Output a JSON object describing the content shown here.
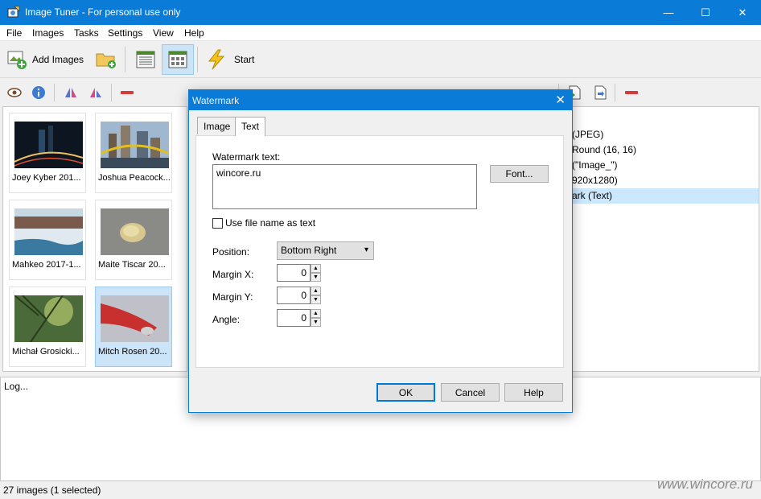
{
  "window": {
    "title": "Image Tuner - For personal use only",
    "controls": {
      "minimize": "—",
      "maximize": "☐",
      "close": "✕"
    }
  },
  "menu": [
    "File",
    "Images",
    "Tasks",
    "Settings",
    "View",
    "Help"
  ],
  "toolbar": {
    "add_images_label": "Add Images",
    "start_label": "Start"
  },
  "thumbnails": [
    {
      "caption": "Joey Kyber  201...",
      "selected": false
    },
    {
      "caption": "Joshua Peacock...",
      "selected": false
    },
    {
      "caption": "Mahkeo  2017-1...",
      "selected": false
    },
    {
      "caption": "Maite Tiscar  20...",
      "selected": false
    },
    {
      "caption": "Michał Grosicki...",
      "selected": false
    },
    {
      "caption": "Mitch Rosen  20...",
      "selected": true
    }
  ],
  "properties": [
    {
      "text": "(JPEG)",
      "selected": false
    },
    {
      "text": "Round (16, 16)",
      "selected": false
    },
    {
      "text": "(\"Image_\")",
      "selected": false
    },
    {
      "text": "920x1280)",
      "selected": false
    },
    {
      "text": "ark (Text)",
      "selected": true
    }
  ],
  "log": {
    "text": "Log..."
  },
  "status": {
    "text": "27 images (1 selected)"
  },
  "site_watermark": "www.wincore.ru",
  "dialog": {
    "title": "Watermark",
    "close": "✕",
    "tabs": [
      {
        "label": "Image",
        "active": false
      },
      {
        "label": "Text",
        "active": true
      }
    ],
    "watermark_text_label": "Watermark text:",
    "watermark_text_value": "wincore.ru",
    "font_button": "Font...",
    "use_filename_label": "Use file name as text",
    "use_filename_checked": false,
    "position_label": "Position:",
    "position_value": "Bottom Right",
    "margin_x_label": "Margin X:",
    "margin_x_value": "0",
    "margin_y_label": "Margin Y:",
    "margin_y_value": "0",
    "angle_label": "Angle:",
    "angle_value": "0",
    "ok_button": "OK",
    "cancel_button": "Cancel",
    "help_button": "Help"
  }
}
